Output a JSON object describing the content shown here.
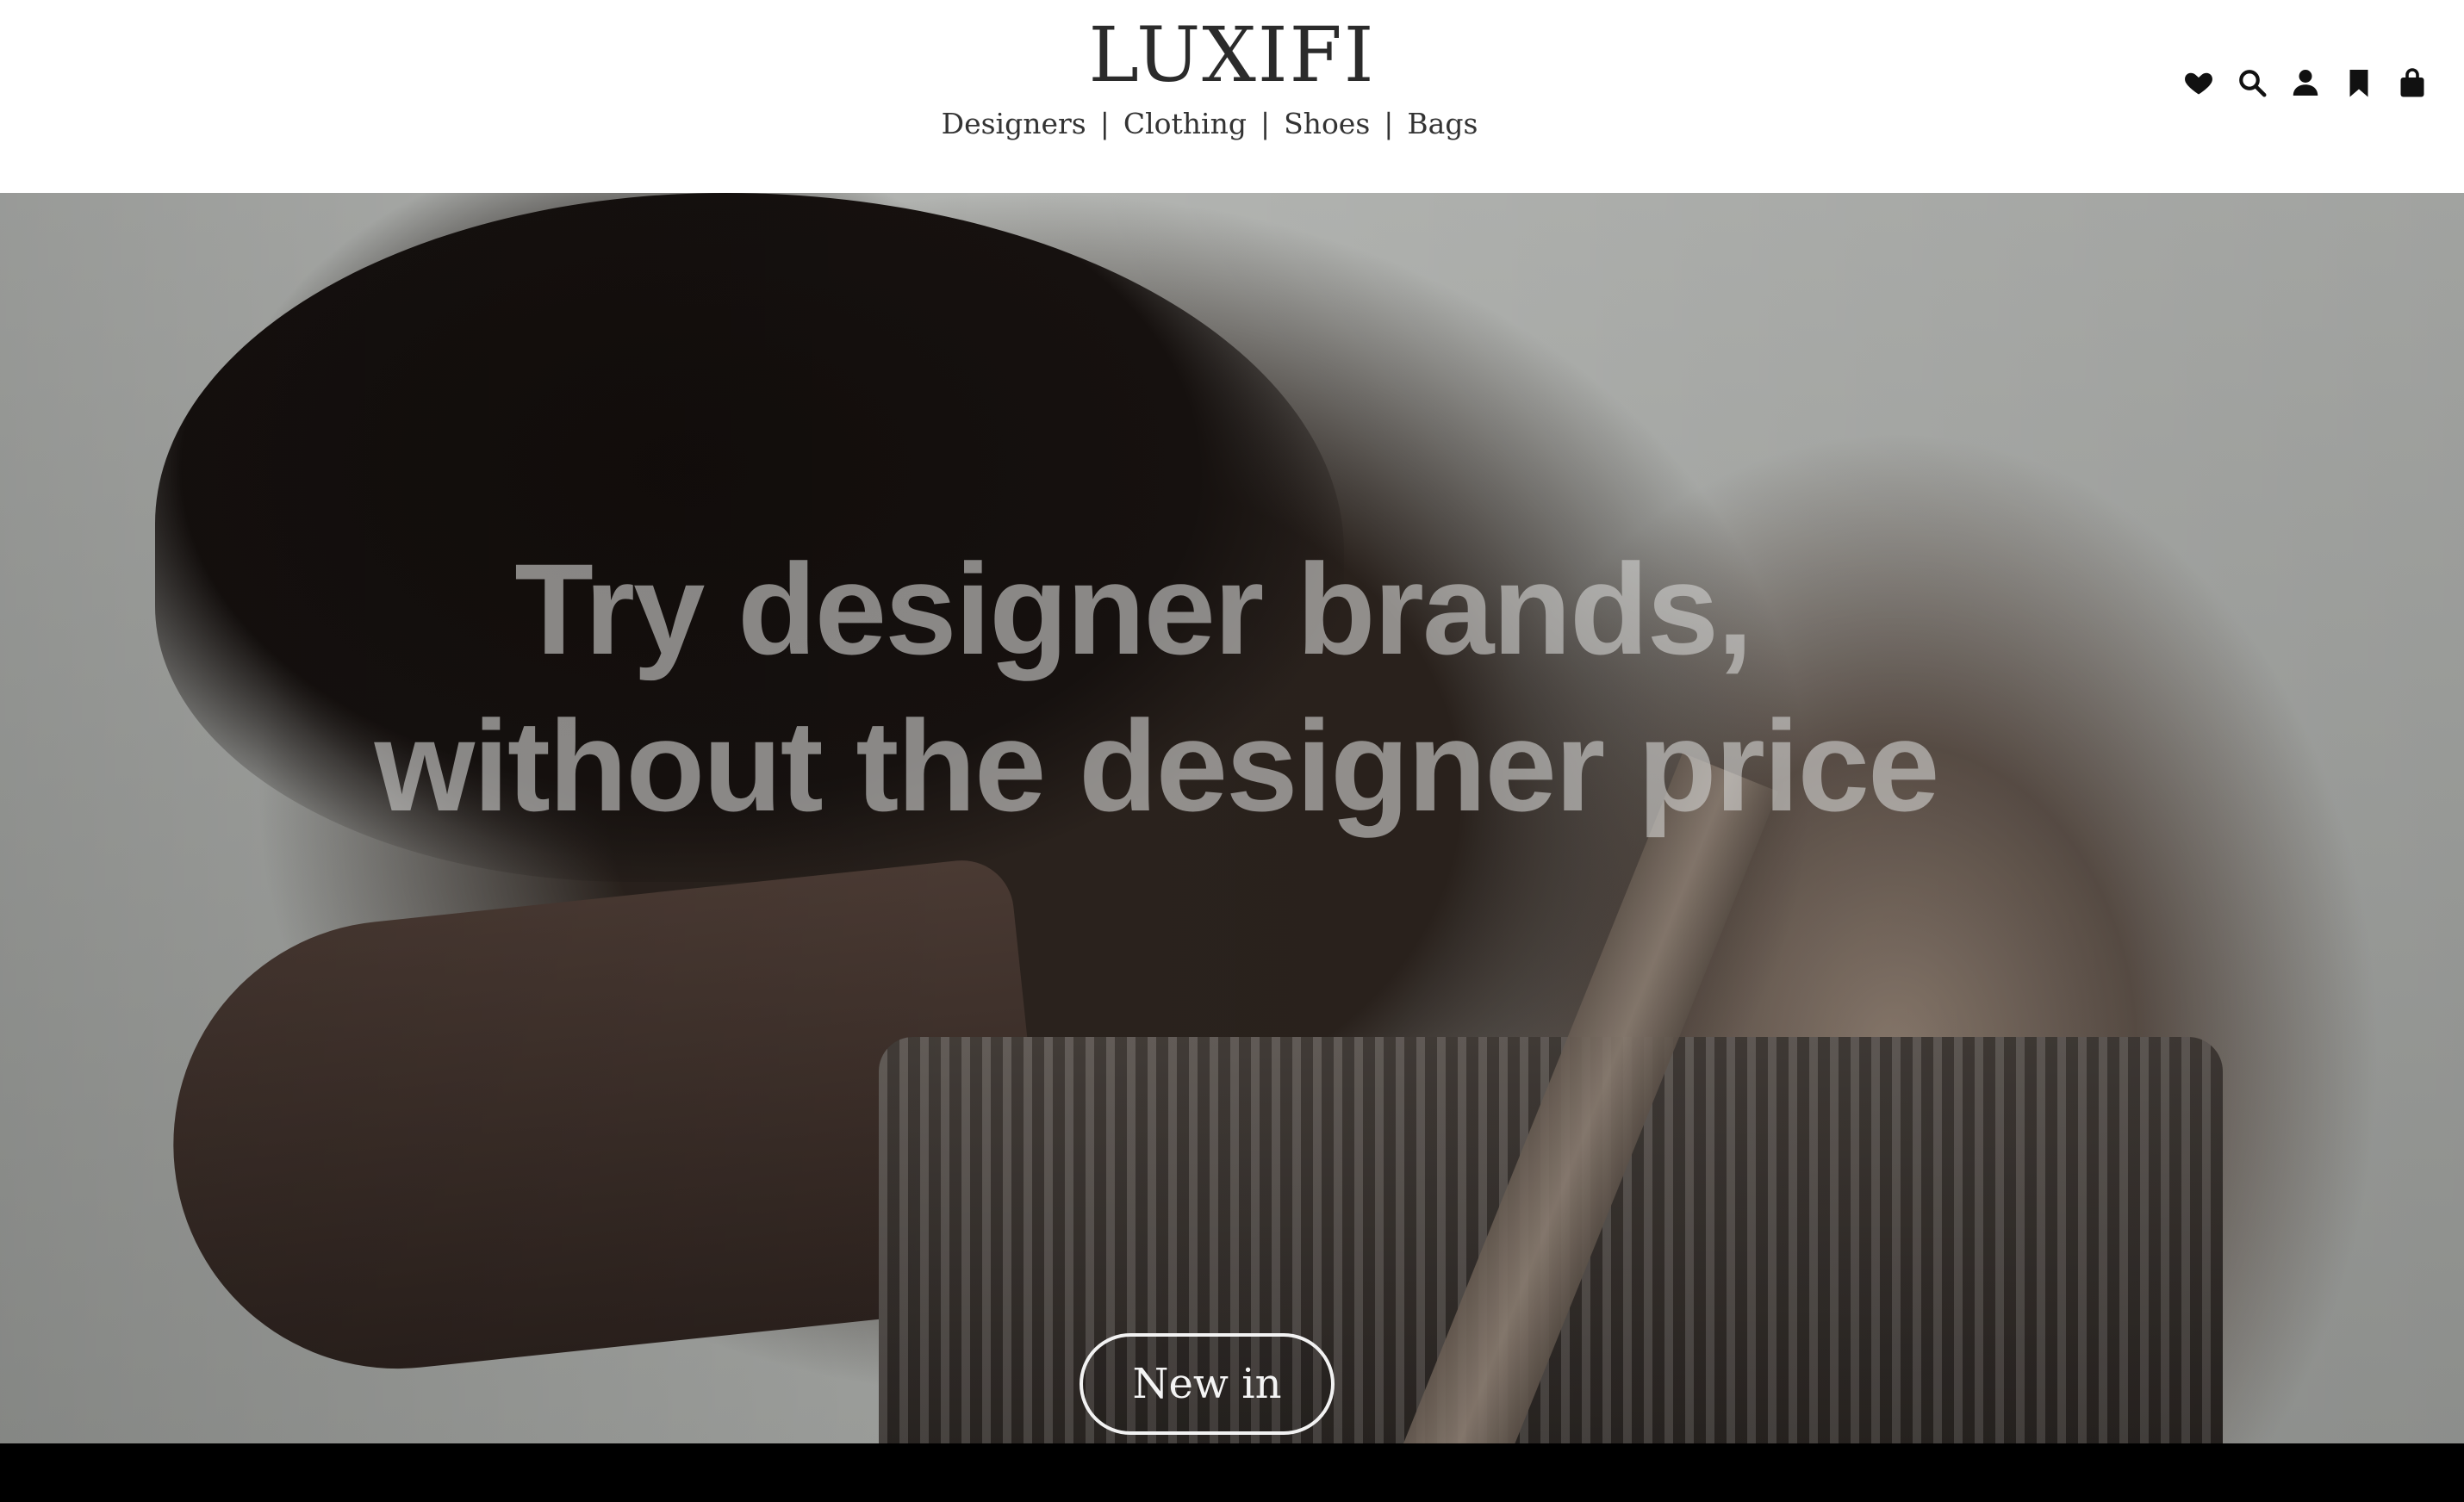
{
  "header": {
    "logo": "LUXIFI",
    "nav": [
      {
        "label": "Designers"
      },
      {
        "label": "Clothing"
      },
      {
        "label": "Shoes"
      },
      {
        "label": "Bags"
      }
    ],
    "nav_separator": "|",
    "icons": [
      "heart-icon",
      "search-icon",
      "user-icon",
      "bookmark-icon",
      "bag-icon"
    ]
  },
  "hero": {
    "headline_line1": "Try designer brands,",
    "headline_line2": "without the designer price",
    "cta_label": "New in"
  },
  "colors": {
    "header_bg": "#ffffff",
    "logo": "#2b2b2b",
    "icon": "#111111",
    "cta_border": "#f2f2f2"
  }
}
